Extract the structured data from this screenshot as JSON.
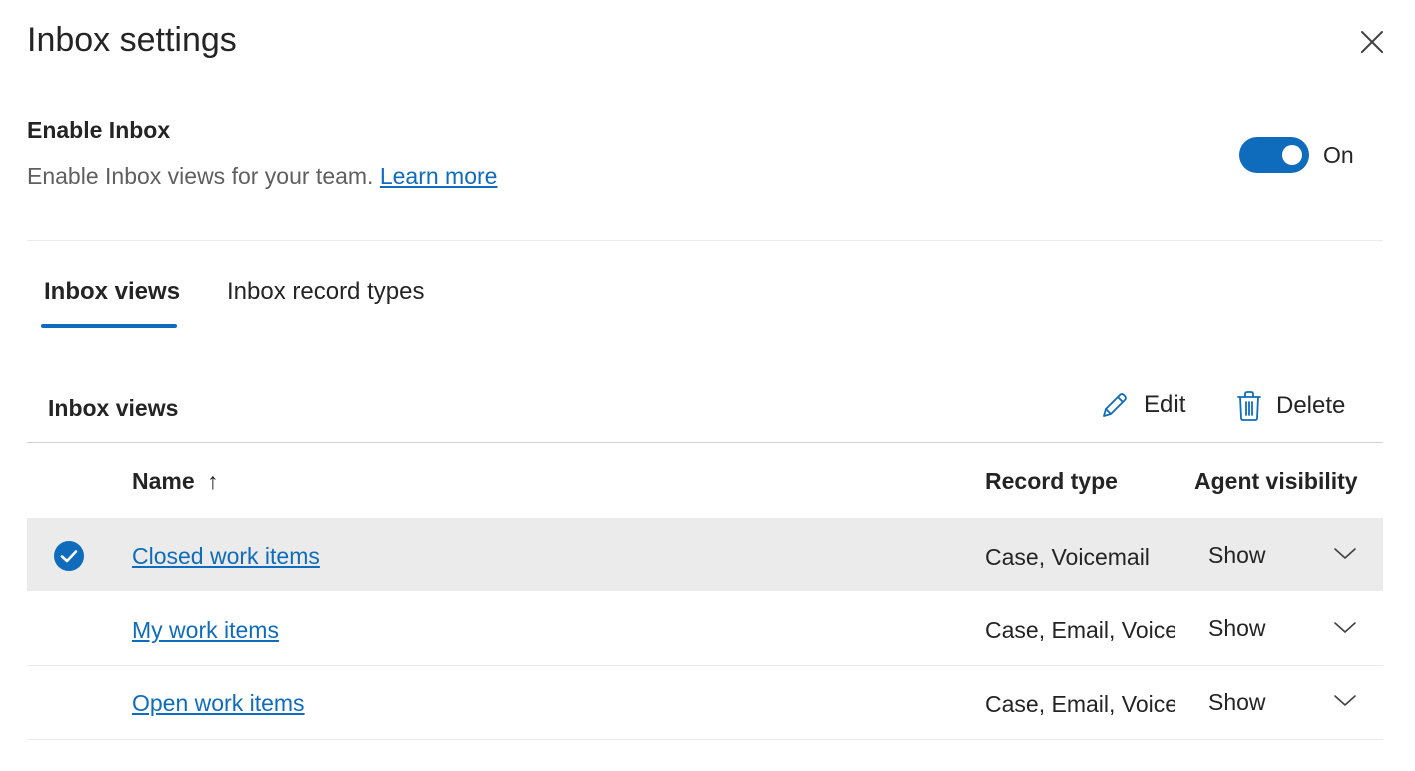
{
  "panel": {
    "title": "Inbox settings"
  },
  "enable": {
    "title": "Enable Inbox",
    "description": "Enable Inbox views for your team.",
    "learn_more": "Learn more",
    "toggle_state": true,
    "toggle_label": "On"
  },
  "tabs": [
    {
      "label": "Inbox views",
      "active": true
    },
    {
      "label": "Inbox record types",
      "active": false
    }
  ],
  "views": {
    "section_title": "Inbox views",
    "commands": {
      "edit": "Edit",
      "delete": "Delete"
    },
    "columns": {
      "name": "Name",
      "sort_indicator": "↑",
      "record_type": "Record type",
      "agent_visibility": "Agent visibility"
    },
    "rows": [
      {
        "name": "Closed work items",
        "record_type": "Case, Voicemail",
        "visibility": "Show",
        "selected": true
      },
      {
        "name": "My work items",
        "record_type": "Case, Email, Voice",
        "visibility": "Show",
        "selected": false
      },
      {
        "name": "Open work items",
        "record_type": "Case, Email, Voice",
        "visibility": "Show",
        "selected": false
      }
    ]
  },
  "colors": {
    "accent": "#0f6cbd",
    "selected_row": "#ebebeb",
    "text": "#242424",
    "secondary_text": "#5f5f5f"
  }
}
